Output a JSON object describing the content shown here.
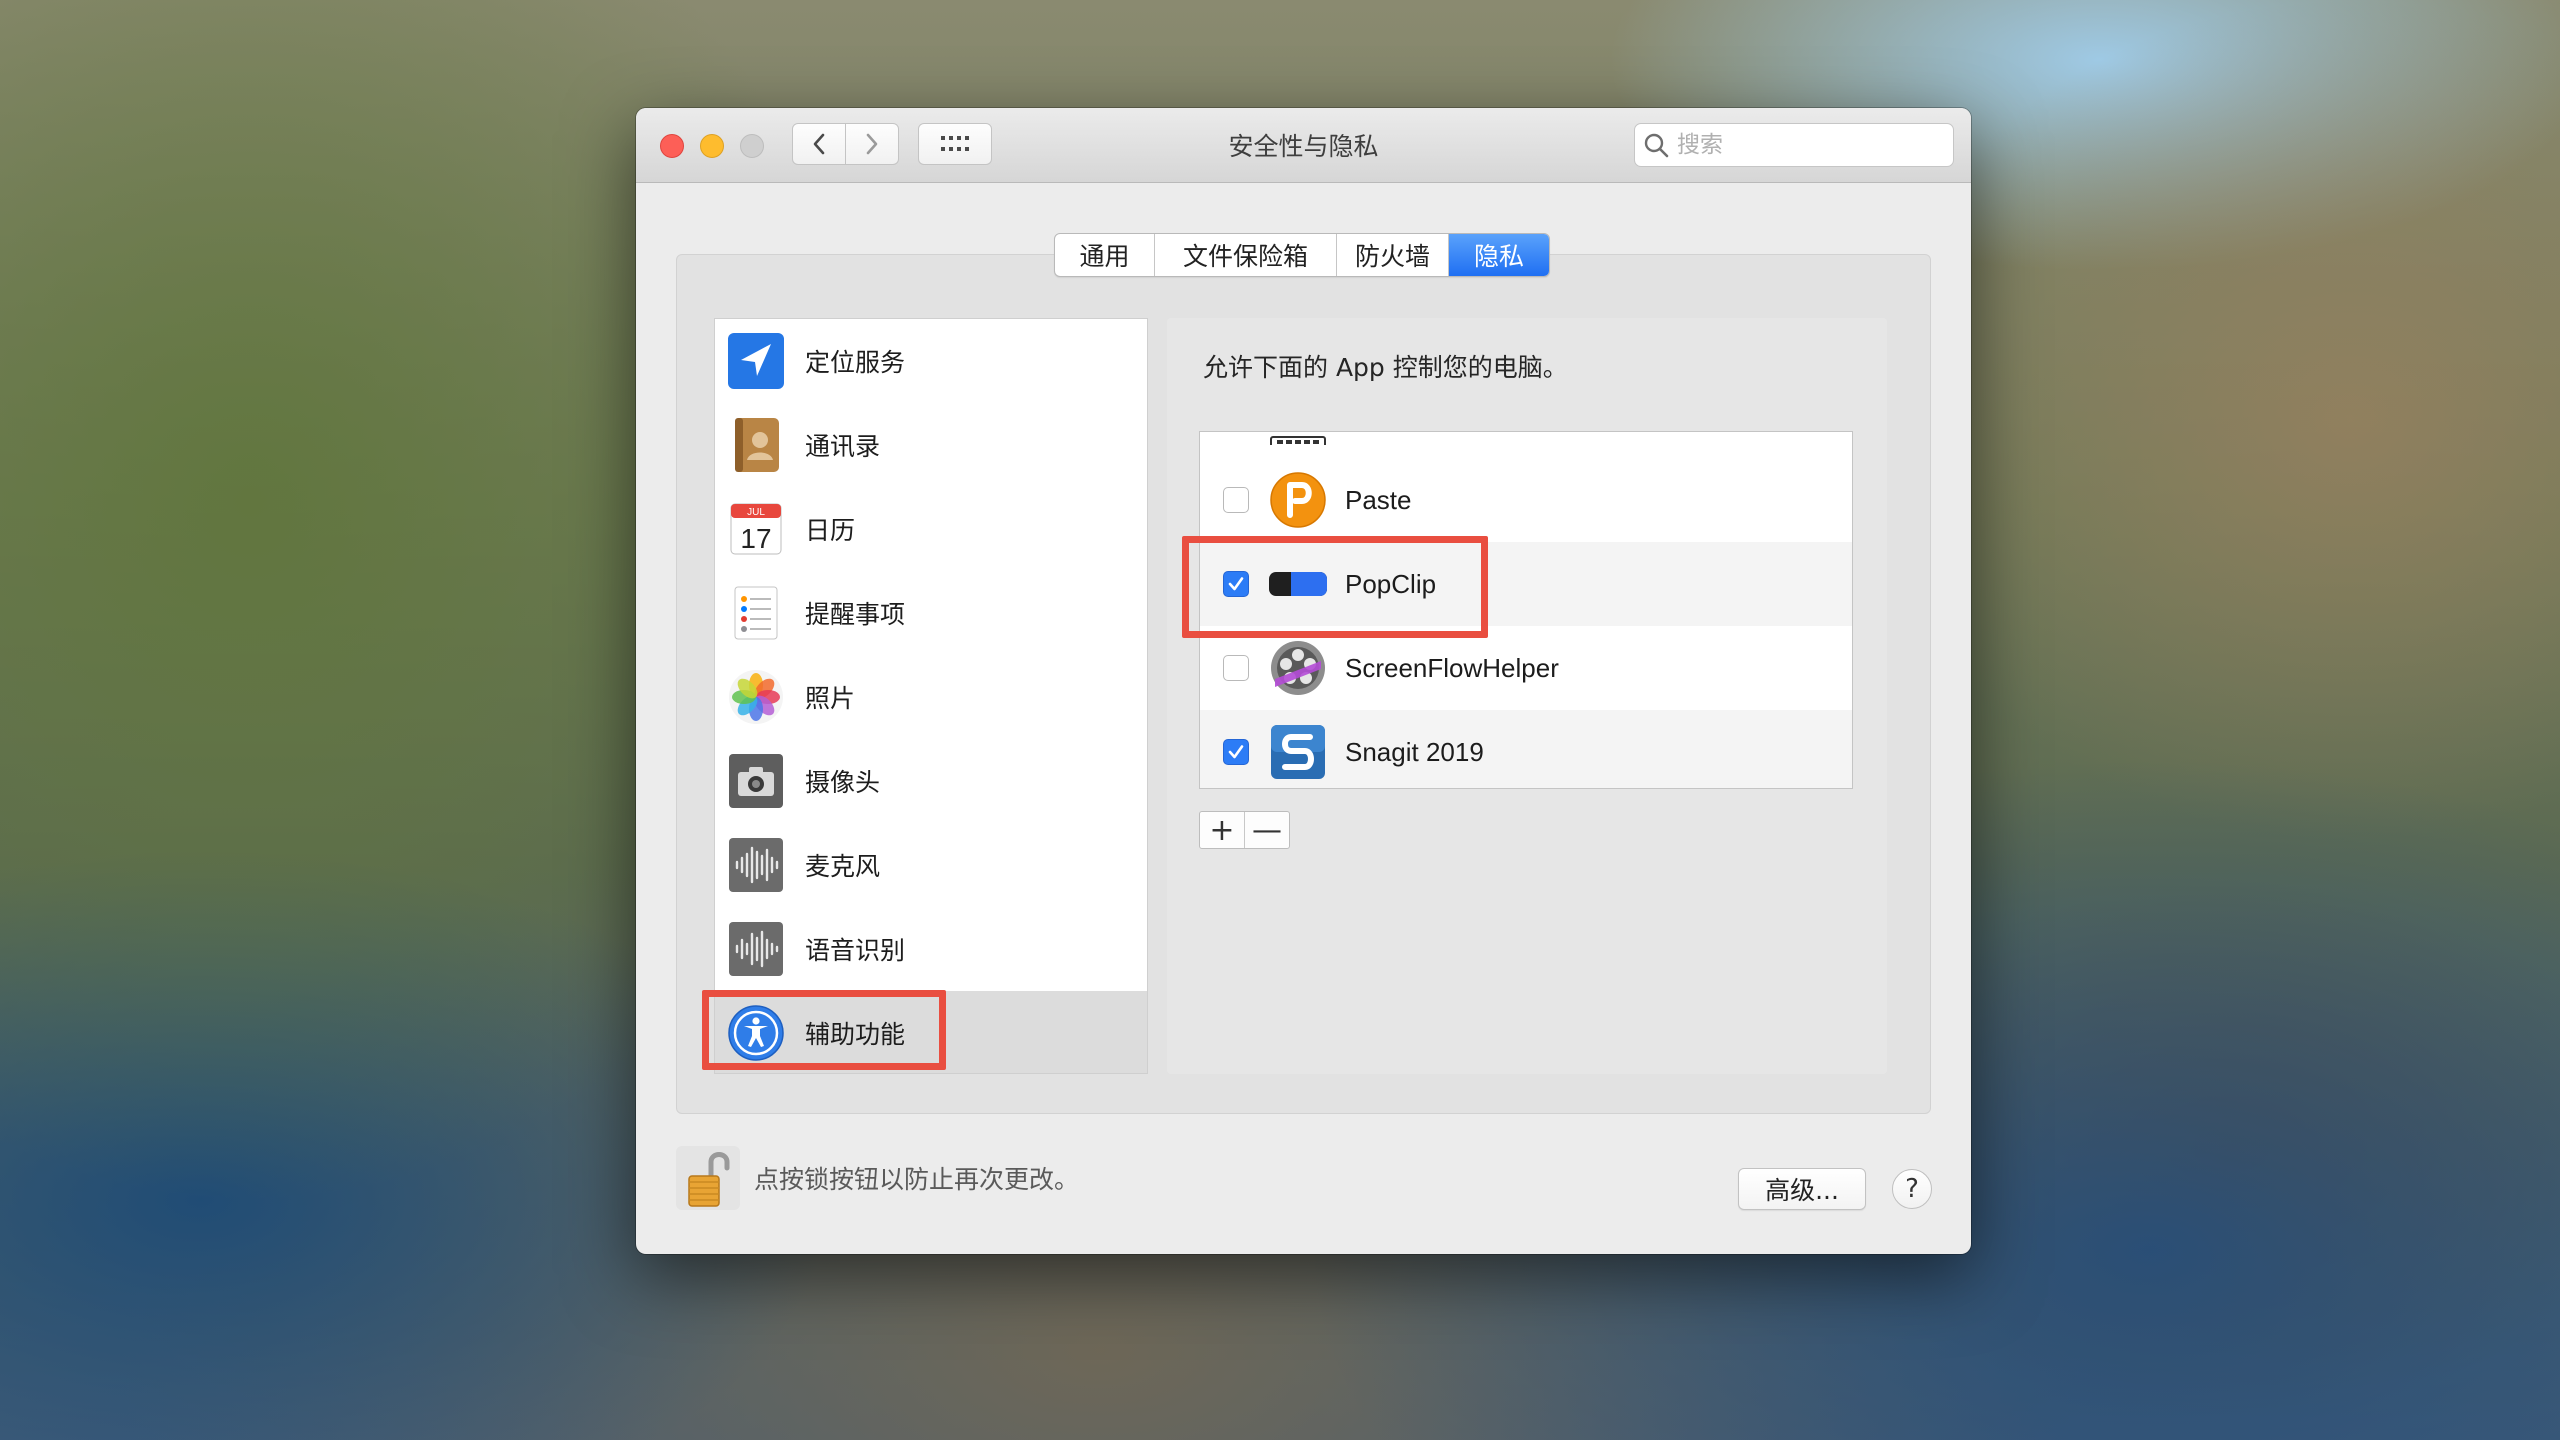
{
  "window": {
    "title": "安全性与隐私",
    "search_placeholder": "搜索"
  },
  "tabs": [
    {
      "label": "通用",
      "active": false
    },
    {
      "label": "文件保险箱",
      "active": false
    },
    {
      "label": "防火墙",
      "active": false
    },
    {
      "label": "隐私",
      "active": true
    }
  ],
  "sidebar": {
    "items": [
      {
        "label": "定位服务",
        "icon": "location-arrow-icon"
      },
      {
        "label": "通讯录",
        "icon": "contacts-book-icon"
      },
      {
        "label": "日历",
        "icon": "calendar-icon",
        "icon_month": "JUL",
        "icon_day": "17"
      },
      {
        "label": "提醒事项",
        "icon": "reminders-icon"
      },
      {
        "label": "照片",
        "icon": "photos-flower-icon"
      },
      {
        "label": "摄像头",
        "icon": "camera-icon"
      },
      {
        "label": "麦克风",
        "icon": "microphone-waveform-icon"
      },
      {
        "label": "语音识别",
        "icon": "speech-waveform-icon"
      },
      {
        "label": "辅助功能",
        "icon": "accessibility-person-icon",
        "selected": true
      }
    ]
  },
  "main": {
    "description": "允许下面的 App 控制您的电脑。",
    "apps": [
      {
        "name": "Paste",
        "checked": false,
        "icon": "paste-p-icon"
      },
      {
        "name": "PopClip",
        "checked": true,
        "icon": "popclip-toggle-icon"
      },
      {
        "name": "ScreenFlowHelper",
        "checked": false,
        "icon": "screenflow-reel-icon"
      },
      {
        "name": "Snagit 2019",
        "checked": true,
        "icon": "snagit-s-icon"
      }
    ],
    "add_label": "+",
    "remove_label": "—"
  },
  "footer": {
    "lock_text": "点按锁按钮以防止再次更改。",
    "advanced_label": "高级...",
    "help_label": "?"
  },
  "colors": {
    "accent_blue": "#2c7cf6",
    "highlight_red": "#e94e40",
    "close": "#fd5f57",
    "minimize": "#febc2e"
  }
}
